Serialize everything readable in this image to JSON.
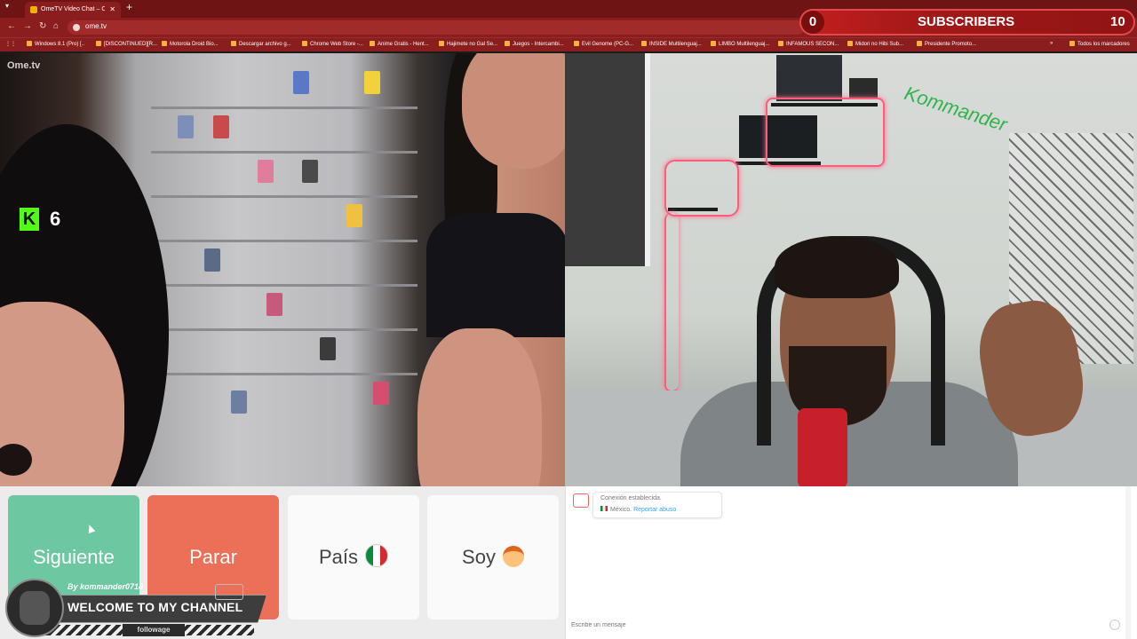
{
  "browser": {
    "tab_title": "OmeTV Video Chat – Ome…",
    "url": "ome.tv",
    "bookmarks": [
      "Windows 8.1 (Pro) [..",
      "[DISCONTINUED][R...",
      "Motorola Droid Bio...",
      "Descargar archivo g...",
      "Chrome Web Store -...",
      "Anime Gratis - Hent...",
      "Hajimete no Gal Se...",
      "Juegos - Intercambi...",
      "Evil Genome (PC-G...",
      "INSIDE Multilenguaj...",
      "LIMBO Multilenguaj...",
      "INFAMOUS SECON...",
      "Midori no Hibi Sub...",
      "Presidente Promoto...",
      "Todos los marcadores"
    ]
  },
  "overlay": {
    "subscribers_count": "0",
    "subscribers_label": "SUBSCRIBERS",
    "subscribers_goal": "10",
    "kick_letter": "K",
    "kick_viewers": "6",
    "welcome_by": "By kommander0718",
    "welcome_text": "WELCOME TO MY CHANNEL",
    "follow_text": "followage"
  },
  "video": {
    "logo_text": "Ome.tv"
  },
  "controls": {
    "next_label": "Siguiente",
    "stop_label": "Parar",
    "country_label": "País",
    "gender_label": "Soy"
  },
  "chat": {
    "status_message": "Conexión establecida.",
    "partner_country": "México.",
    "report_link": "Reportar abuso",
    "input_placeholder": "Escribe un mensaje"
  },
  "colors": {
    "browser_frame": "#8a1d1d",
    "next_button": "#6dc8a1",
    "stop_button": "#ec6f57",
    "kick_green": "#53fc18"
  }
}
